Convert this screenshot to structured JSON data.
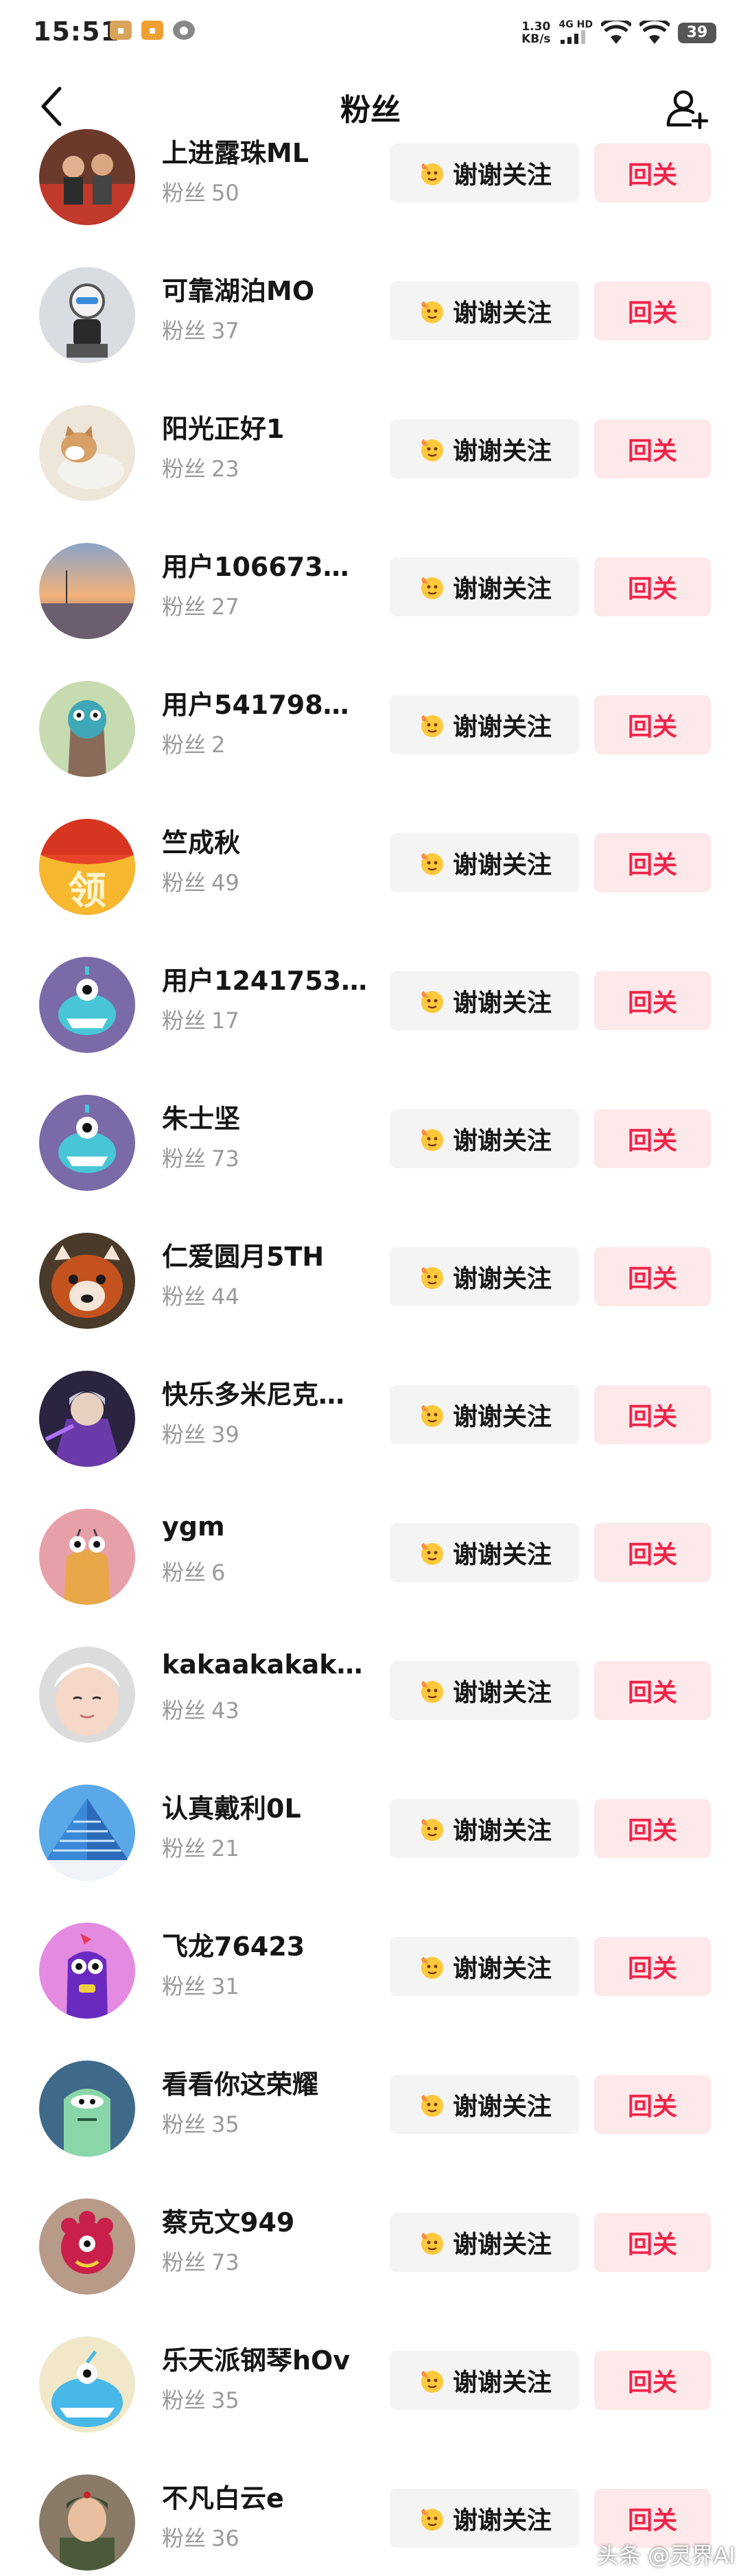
{
  "status_bar": {
    "time": "15:51",
    "speed_value": "1.30",
    "speed_unit": "KB/s",
    "network": "4G HD",
    "battery": "39",
    "icons": [
      "app-badge-icon",
      "app-orange-icon",
      "wechat-icon",
      "signal-icon",
      "wifi-icon",
      "wifi-icon",
      "battery-icon"
    ]
  },
  "nav": {
    "title": "粉丝",
    "back_icon": "chevron-left-icon",
    "add_icon": "add-user-icon"
  },
  "buttons": {
    "thanks_label": "谢谢关注",
    "thanks_icon": "wave-hand-emoji-icon",
    "follow_back_label": "回关"
  },
  "count_label": "粉丝",
  "fans": [
    {
      "name": "上进露珠ML",
      "followers": "50",
      "avatar": "photo-people-on-sofa"
    },
    {
      "name": "可靠湖泊MO",
      "followers": "37",
      "avatar": "photo-robot-figure"
    },
    {
      "name": "阳光正好1",
      "followers": "23",
      "avatar": "photo-shiba-dog"
    },
    {
      "name": "用户106673…",
      "followers": "27",
      "avatar": "photo-sunset-beach"
    },
    {
      "name": "用户541798…",
      "followers": "2",
      "avatar": "cartoon-green-monster"
    },
    {
      "name": "竺成秋",
      "followers": "49",
      "avatar": "red-coupon-badge"
    },
    {
      "name": "用户1241753…",
      "followers": "17",
      "avatar": "cartoon-blue-monster"
    },
    {
      "name": "朱士坚",
      "followers": "73",
      "avatar": "cartoon-blue-monster"
    },
    {
      "name": "仁爱圆月5TH",
      "followers": "44",
      "avatar": "photo-red-panda"
    },
    {
      "name": "快乐多米尼克…",
      "followers": "39",
      "avatar": "photo-game-character"
    },
    {
      "name": "ygm",
      "followers": "6",
      "avatar": "cartoon-orange-monster"
    },
    {
      "name": "kakaakakak…",
      "followers": "43",
      "avatar": "photo-baby"
    },
    {
      "name": "认真戴利0L",
      "followers": "21",
      "avatar": "photo-building"
    },
    {
      "name": "飞龙76423",
      "followers": "31",
      "avatar": "cartoon-purple-monster"
    },
    {
      "name": "看看你这荣耀",
      "followers": "35",
      "avatar": "cartoon-green-ghost"
    },
    {
      "name": "蔡克文949",
      "followers": "73",
      "avatar": "cartoon-pink-monster"
    },
    {
      "name": "乐天派钢琴hOv",
      "followers": "35",
      "avatar": "cartoon-cyan-monster"
    },
    {
      "name": "不凡白云e",
      "followers": "36",
      "avatar": "photo-soldier-portrait"
    }
  ],
  "watermark": "头条 @灵界AI",
  "colors": {
    "accent_red": "#f0244a",
    "follow_bg": "#fde8ea",
    "thanks_bg": "#f4f4f5",
    "muted_text": "#9a9a9a"
  }
}
